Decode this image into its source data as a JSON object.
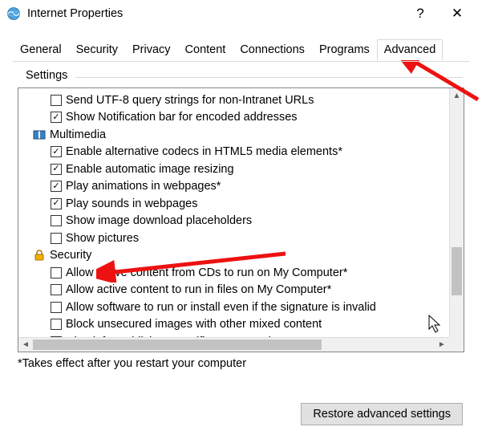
{
  "window": {
    "title": "Internet Properties",
    "help": "?",
    "close": "✕"
  },
  "tabs": [
    "General",
    "Security",
    "Privacy",
    "Content",
    "Connections",
    "Programs",
    "Advanced"
  ],
  "active_tab_index": 6,
  "group": {
    "label": "Settings",
    "footnote": "*Takes effect after you restart your computer",
    "restore": "Restore advanced settings"
  },
  "items": [
    {
      "kind": "check",
      "checked": false,
      "label": "Send UTF-8 query strings for non-Intranet URLs"
    },
    {
      "kind": "check",
      "checked": true,
      "label": "Show Notification bar for encoded addresses"
    },
    {
      "kind": "category",
      "icon": "multimedia",
      "label": "Multimedia"
    },
    {
      "kind": "check",
      "checked": true,
      "label": "Enable alternative codecs in HTML5 media elements*"
    },
    {
      "kind": "check",
      "checked": true,
      "label": "Enable automatic image resizing"
    },
    {
      "kind": "check",
      "checked": true,
      "label": "Play animations in webpages*"
    },
    {
      "kind": "check",
      "checked": true,
      "label": "Play sounds in webpages"
    },
    {
      "kind": "check",
      "checked": false,
      "label": "Show image download placeholders"
    },
    {
      "kind": "check",
      "checked": false,
      "label": "Show pictures"
    },
    {
      "kind": "category",
      "icon": "security",
      "label": "Security"
    },
    {
      "kind": "check",
      "checked": false,
      "label": "Allow active content from CDs to run on My Computer*"
    },
    {
      "kind": "check",
      "checked": false,
      "label": "Allow active content to run in files on My Computer*"
    },
    {
      "kind": "check",
      "checked": false,
      "label": "Allow software to run or install even if the signature is invalid"
    },
    {
      "kind": "check",
      "checked": false,
      "label": "Block unsecured images with other mixed content"
    },
    {
      "kind": "check",
      "checked": true,
      "label": "Check for publisher's certificate revocation"
    }
  ]
}
